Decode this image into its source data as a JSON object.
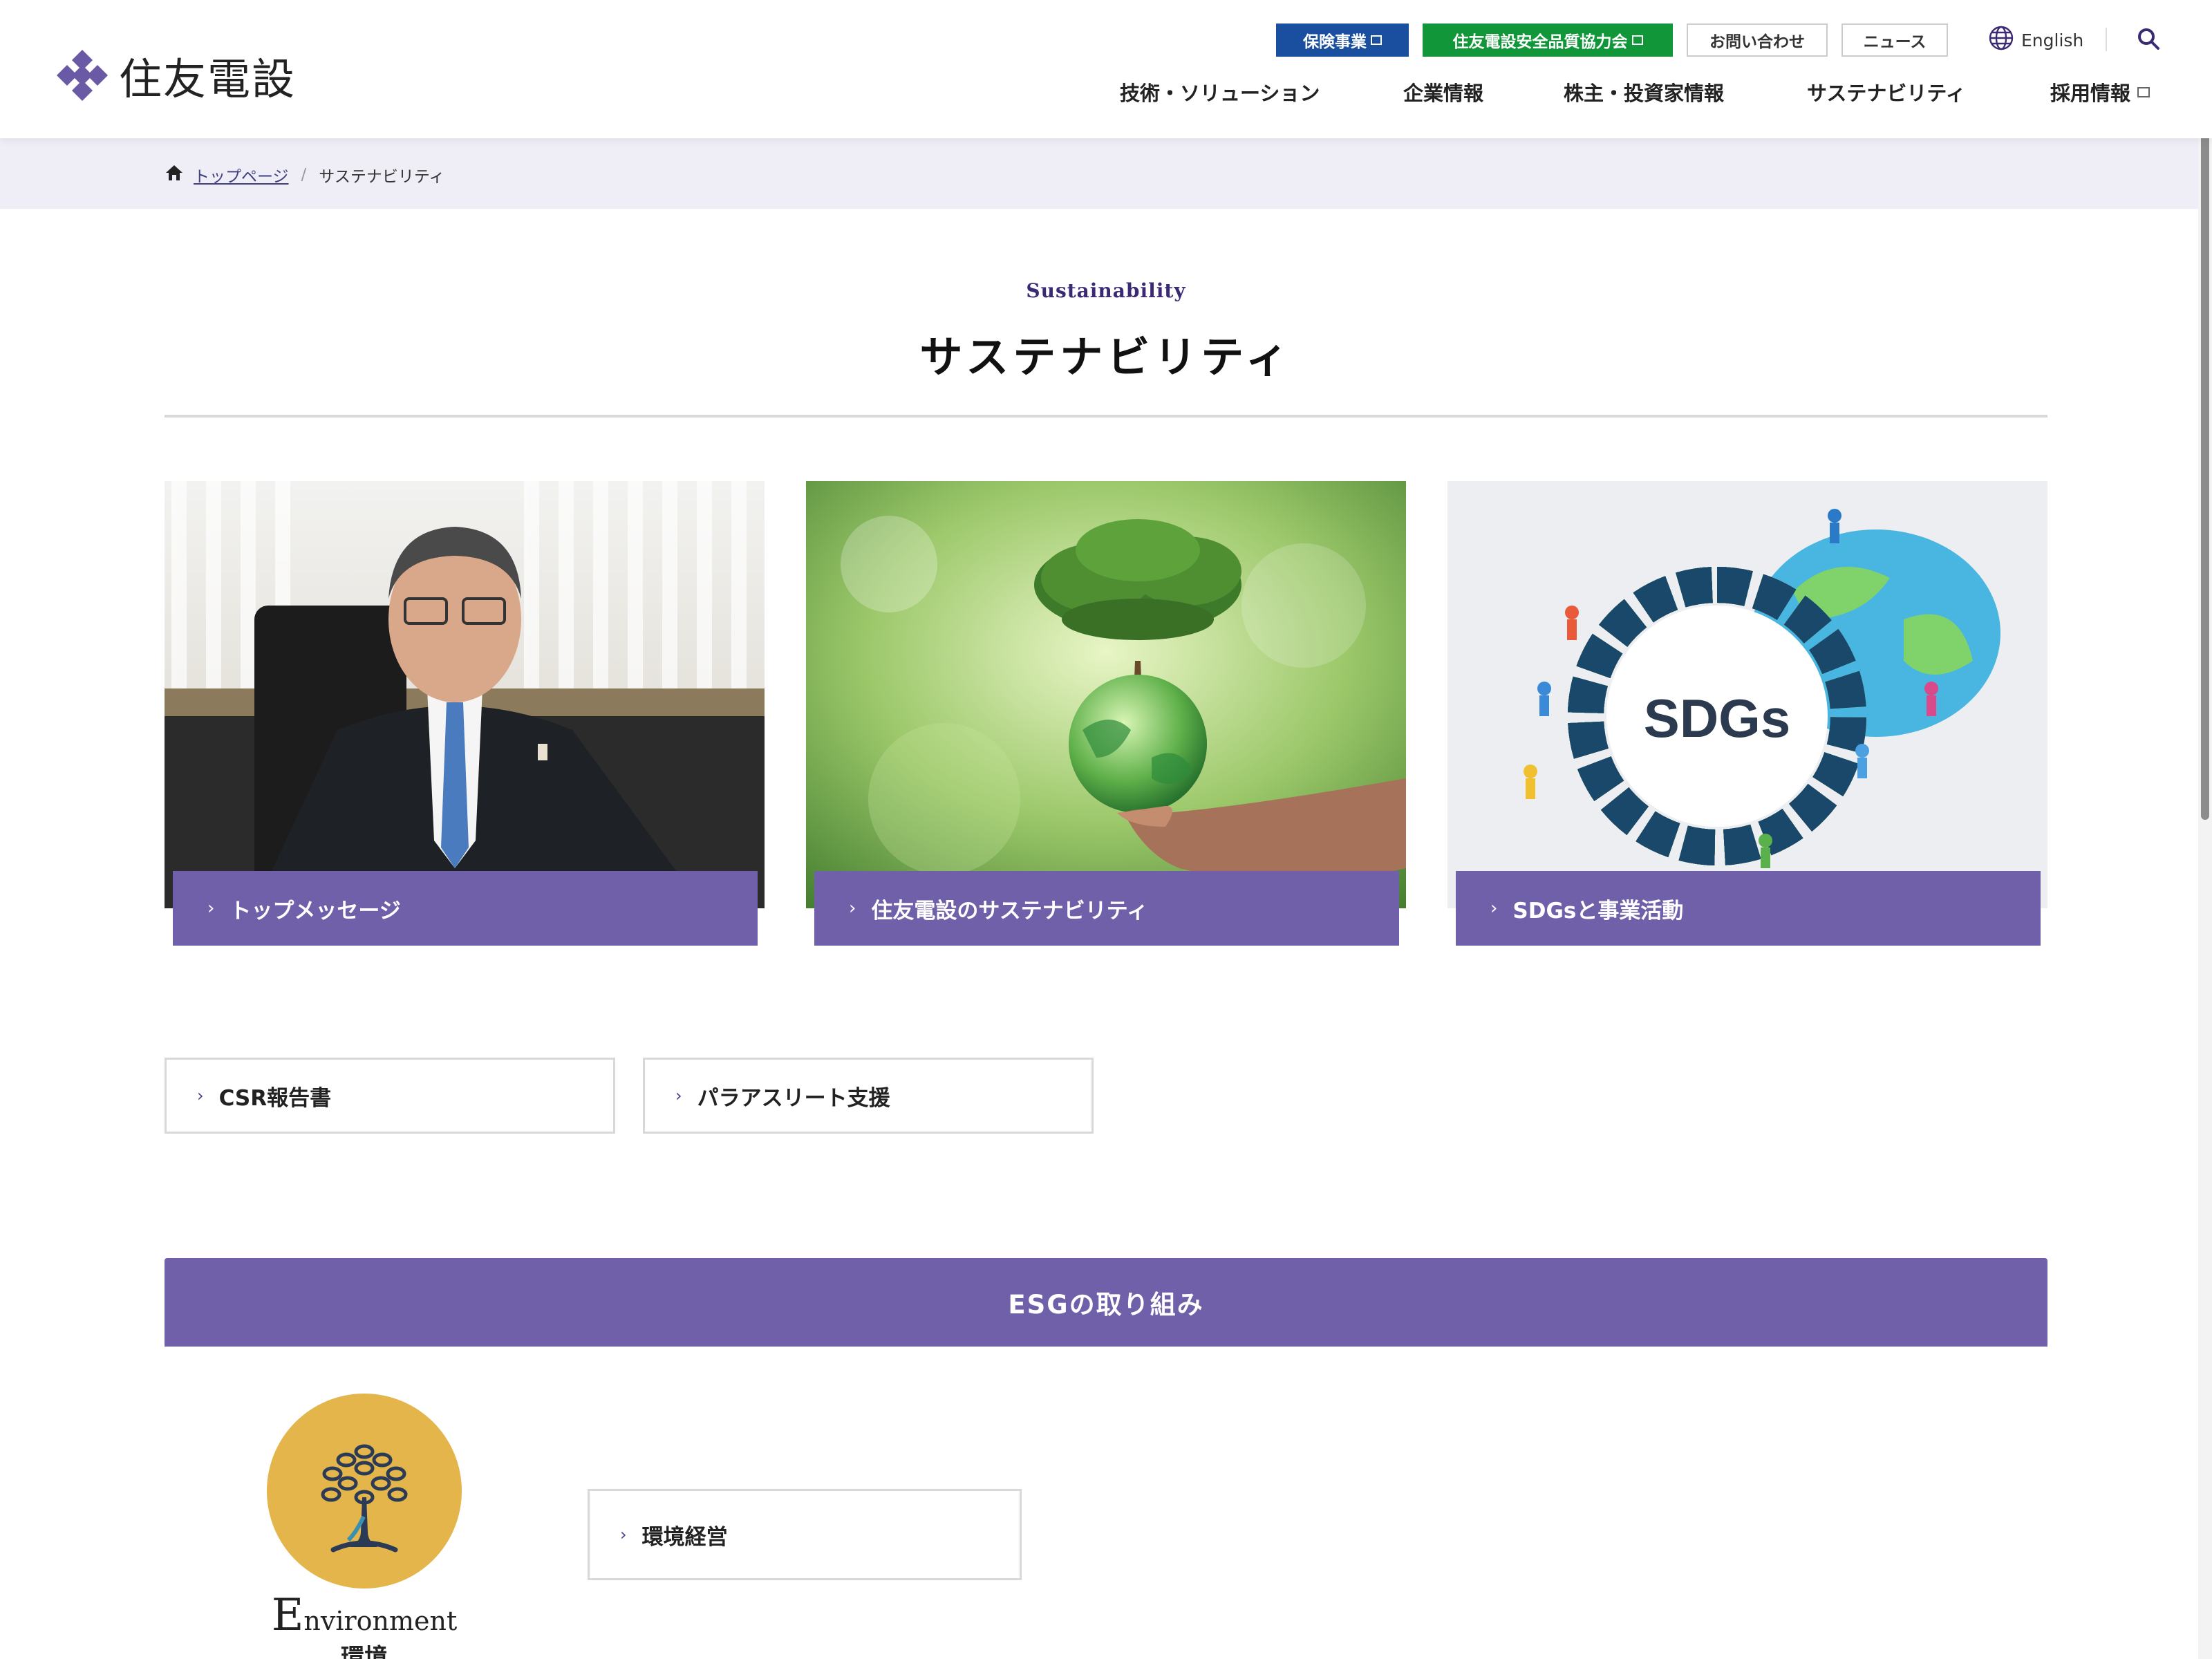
{
  "header": {
    "logo_text": "住友電設",
    "utility_links": {
      "insurance": "保険事業",
      "safety_council": "住友電設安全品質協力会",
      "contact": "お問い合わせ",
      "news": "ニュース"
    },
    "language": "English",
    "nav": {
      "tech": "技術・ソリューション",
      "company": "企業情報",
      "ir": "株主・投資家情報",
      "sustainability": "サステナビリティ",
      "recruit": "採用情報"
    }
  },
  "breadcrumb": {
    "home": "トップページ",
    "separator": "/",
    "current": "サステナビリティ"
  },
  "page": {
    "subtitle_en": "Sustainability",
    "title": "サステナビリティ"
  },
  "cards": [
    {
      "label": "トップメッセージ"
    },
    {
      "label": "住友電設のサステナビリティ"
    },
    {
      "label": "SDGsと事業活動",
      "image_text": "SDGs"
    }
  ],
  "links": {
    "csr": "CSR報告書",
    "para": "パラアスリート支援"
  },
  "esg": {
    "heading": "ESGの取り組み",
    "environment": {
      "en_cap": "E",
      "en_rest": "nvironment",
      "jp": "環境",
      "link": "環境経営"
    }
  },
  "colors": {
    "brand_purple": "#7060aa",
    "insurance_blue": "#1a4fa0",
    "safety_green": "#12963a",
    "env_gold": "#e3b54a"
  },
  "icons": [
    "logo-mark-icon",
    "external-link-icon",
    "globe-icon",
    "search-icon",
    "home-icon",
    "chevron-right-icon",
    "tree-icon"
  ]
}
